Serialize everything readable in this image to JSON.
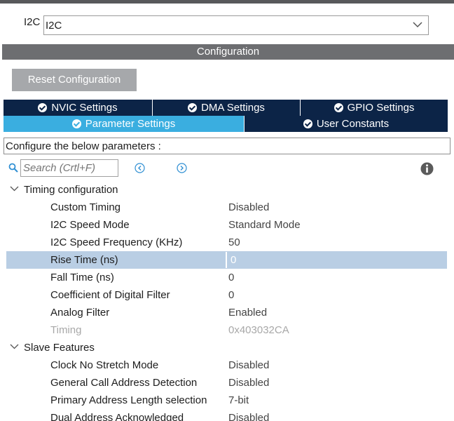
{
  "mode": {
    "label": "I2C",
    "selected": "I2C"
  },
  "config_title": "Configuration",
  "reset_button": "Reset Configuration",
  "tabs_row1": [
    {
      "label": "NVIC Settings"
    },
    {
      "label": "DMA Settings"
    },
    {
      "label": "GPIO Settings"
    }
  ],
  "tabs_row2": [
    {
      "label": "Parameter Settings",
      "active": true
    },
    {
      "label": "User Constants"
    }
  ],
  "hint": "Configure the below parameters :",
  "search": {
    "placeholder": "Search (Crtl+F)"
  },
  "groups": [
    {
      "name": "Timing configuration",
      "params": [
        {
          "name": "Custom Timing",
          "value": "Disabled"
        },
        {
          "name": "I2C Speed Mode",
          "value": "Standard Mode"
        },
        {
          "name": "I2C Speed Frequency (KHz)",
          "value": "50"
        },
        {
          "name": "Rise Time (ns)",
          "value": "0",
          "selected": true
        },
        {
          "name": "Fall Time (ns)",
          "value": "0"
        },
        {
          "name": "Coefficient of Digital Filter",
          "value": "0"
        },
        {
          "name": "Analog Filter",
          "value": "Enabled"
        },
        {
          "name": "Timing",
          "value": "0x403032CA",
          "disabled": true
        }
      ]
    },
    {
      "name": "Slave Features",
      "params": [
        {
          "name": "Clock No Stretch Mode",
          "value": "Disabled"
        },
        {
          "name": "General Call Address Detection",
          "value": "Disabled"
        },
        {
          "name": "Primary Address Length selection",
          "value": "7-bit"
        },
        {
          "name": "Dual Address Acknowledged",
          "value": "Disabled"
        }
      ]
    }
  ],
  "colors": {
    "tab_dark": "#0c2447",
    "tab_active": "#3aaee0",
    "config_bar": "#6d6e71",
    "selected_row": "#b9cee4",
    "reset_button": "#a6a8ab"
  }
}
